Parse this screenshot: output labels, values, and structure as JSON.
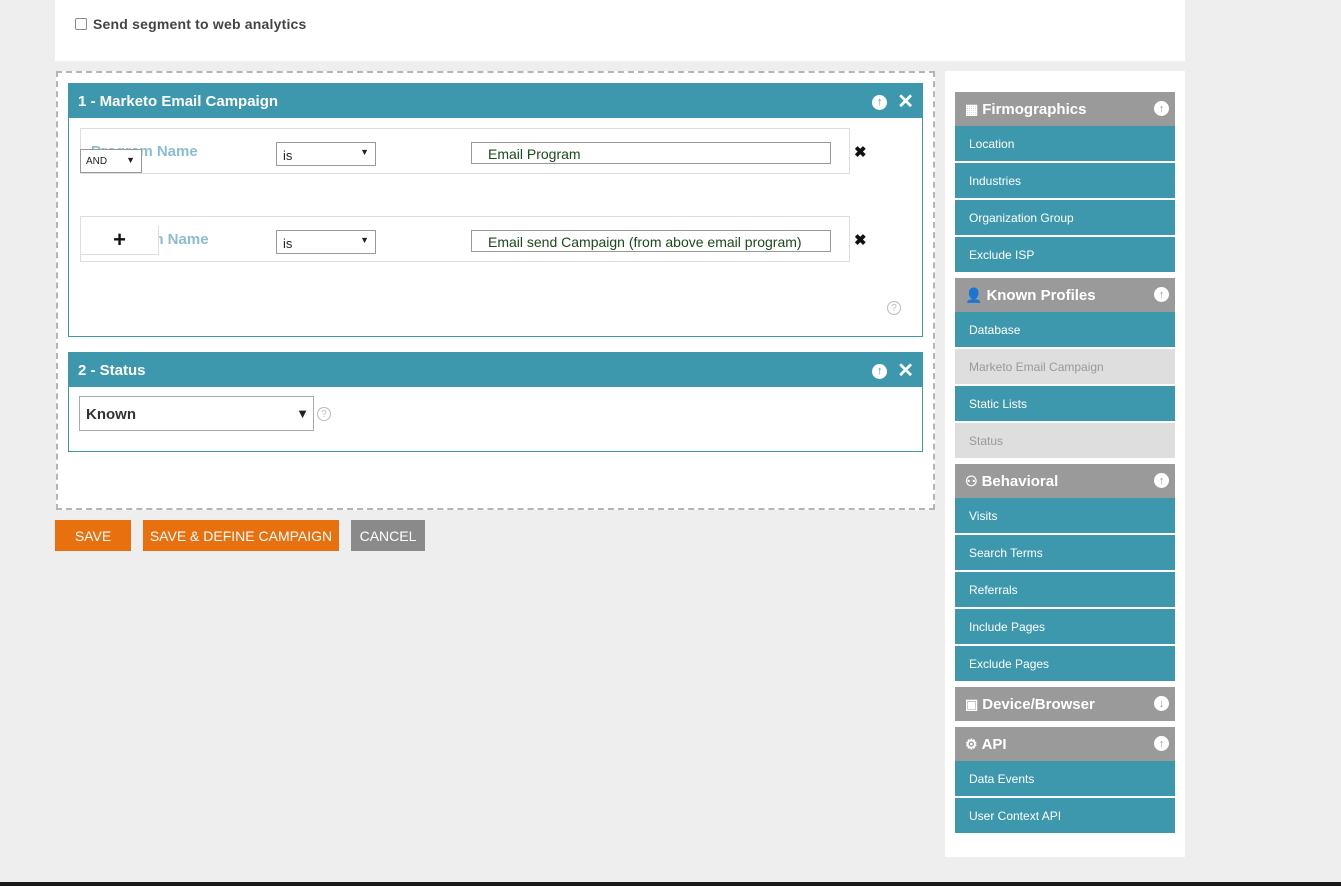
{
  "top": {
    "send_segment_label": "Send segment to web analytics"
  },
  "block1": {
    "title": "1 - Marketo Email Campaign",
    "rows": [
      {
        "label": "Program Name",
        "operator": "is",
        "value": "Email Program"
      },
      {
        "label": "Campaign Name",
        "operator": "is",
        "value": "Email send Campaign (from above email program)"
      }
    ],
    "conjunction": "AND",
    "add_symbol": "+"
  },
  "block2": {
    "title": "2 - Status",
    "value": "Known"
  },
  "buttons": {
    "save": "SAVE",
    "save_define": "SAVE & DEFINE CAMPAIGN",
    "cancel": "CANCEL"
  },
  "sidebar": {
    "firmographics": {
      "title": "Firmographics",
      "items": [
        "Location",
        "Industries",
        "Organization Group",
        "Exclude ISP"
      ]
    },
    "known_profiles": {
      "title": "Known Profiles",
      "items": [
        "Database",
        "Marketo Email Campaign",
        "Static Lists",
        "Status"
      ]
    },
    "behavioral": {
      "title": "Behavioral",
      "items": [
        "Visits",
        "Search Terms",
        "Referrals",
        "Include Pages",
        "Exclude Pages"
      ]
    },
    "device_browser": {
      "title": "Device/Browser"
    },
    "api": {
      "title": "API",
      "items": [
        "Data Events",
        "User Context API"
      ]
    }
  },
  "colors": {
    "accent": "#3d98ad",
    "orange": "#e8700e",
    "gray_header": "#9a9a9a",
    "cancel": "#8a8a8a"
  }
}
